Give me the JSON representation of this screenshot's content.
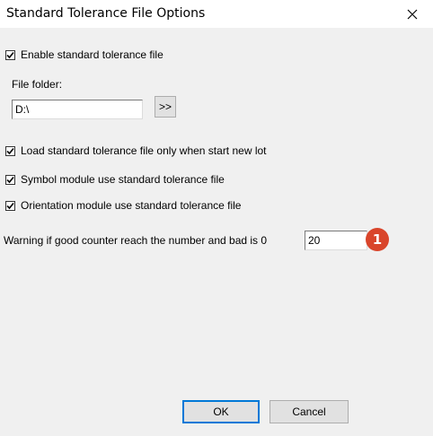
{
  "window": {
    "title": "Standard Tolerance File Options",
    "close_glyph": "×"
  },
  "options": {
    "enable_std_file": {
      "label": "Enable standard tolerance file",
      "checked": true
    },
    "load_on_new_lot": {
      "label": "Load standard tolerance file only when start new lot",
      "checked": true
    },
    "symbol_module": {
      "label": "Symbol module use standard tolerance file",
      "checked": true
    },
    "orientation_module": {
      "label": "Orientation module use standard tolerance file",
      "checked": true
    }
  },
  "folder": {
    "label": "File folder:",
    "value": "D:\\",
    "browse_label": ">>"
  },
  "warning": {
    "label": "Warning if good counter reach the number and bad is 0",
    "value": "20"
  },
  "annotation": {
    "badge": "1"
  },
  "buttons": {
    "ok": "OK",
    "cancel": "Cancel"
  },
  "colors": {
    "accent": "#0078d7",
    "badge": "#d9452b",
    "background": "#f0f0f0"
  }
}
